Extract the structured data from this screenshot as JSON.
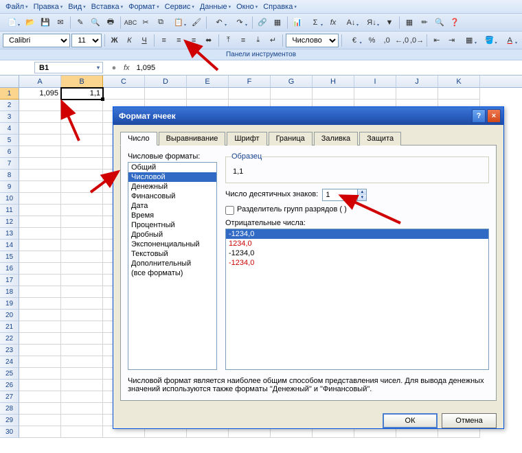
{
  "menu": {
    "items": [
      "Файл",
      "Правка",
      "Вид",
      "Вставка",
      "Формат",
      "Сервис",
      "Данные",
      "Окно",
      "Справка"
    ]
  },
  "toolbar2": {
    "font": "Calibri",
    "size": "11",
    "format_select": "Числово",
    "panel_label": "Панели инструментов"
  },
  "formula_bar": {
    "cell_ref": "B1",
    "fx": "fx",
    "value": "1,095"
  },
  "grid": {
    "columns": [
      "A",
      "B",
      "C",
      "D",
      "E",
      "F",
      "G",
      "H",
      "I",
      "J",
      "K"
    ],
    "rows": 30,
    "active_col": "B",
    "active_row": 1,
    "cells": {
      "A1": "1,095",
      "B1": "1,1"
    }
  },
  "dialog": {
    "title": "Формат ячеек",
    "help_icon": "?",
    "close_icon": "×",
    "tabs": [
      "Число",
      "Выравнивание",
      "Шрифт",
      "Граница",
      "Заливка",
      "Защита"
    ],
    "active_tab": 0,
    "formats_label": "Числовые форматы:",
    "formats": [
      "Общий",
      "Числовой",
      "Денежный",
      "Финансовый",
      "Дата",
      "Время",
      "Процентный",
      "Дробный",
      "Экспоненциальный",
      "Текстовый",
      "Дополнительный",
      "(все форматы)"
    ],
    "selected_format": 1,
    "sample_label": "Образец",
    "sample_value": "1,1",
    "decimals_label": "Число десятичных знаков:",
    "decimals_value": "1",
    "separator_label": "Разделитель групп разрядов ( )",
    "negative_label": "Отрицательные числа:",
    "negatives": [
      {
        "text": "-1234,0",
        "red": false,
        "sel": true
      },
      {
        "text": "1234,0",
        "red": true,
        "sel": false
      },
      {
        "text": "-1234,0",
        "red": false,
        "sel": false
      },
      {
        "text": "-1234,0",
        "red": true,
        "sel": false
      }
    ],
    "description": "Числовой формат является наиболее общим способом представления чисел. Для вывода денежных значений используются также форматы \"Денежный\" и \"Финансовый\".",
    "ok": "ОК",
    "cancel": "Отмена"
  }
}
